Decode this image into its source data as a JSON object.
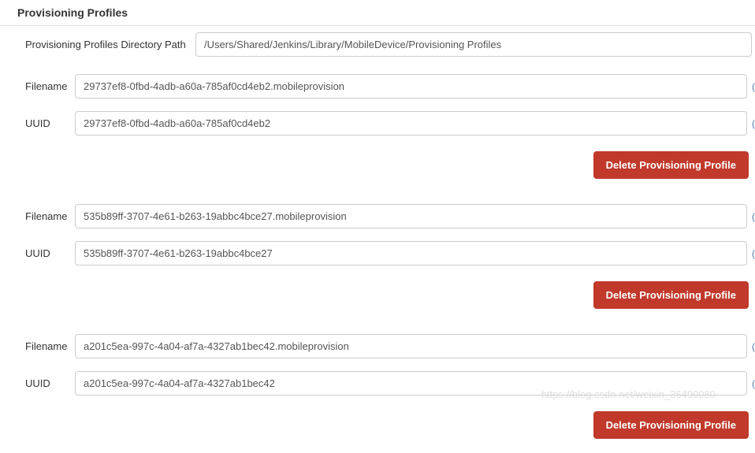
{
  "section_title": "Provisioning Profiles",
  "directory_path": {
    "label": "Provisioning Profiles Directory Path",
    "value": "/Users/Shared/Jenkins/Library/MobileDevice/Provisioning Profiles"
  },
  "filename_label": "Filename",
  "uuid_label": "UUID",
  "delete_button_label": "Delete Provisioning Profile",
  "profiles": [
    {
      "filename": "29737ef8-0fbd-4adb-a60a-785af0cd4eb2.mobileprovision",
      "uuid": "29737ef8-0fbd-4adb-a60a-785af0cd4eb2"
    },
    {
      "filename": "535b89ff-3707-4e61-b263-19abbc4bce27.mobileprovision",
      "uuid": "535b89ff-3707-4e61-b263-19abbc4bce27"
    },
    {
      "filename": "a201c5ea-997c-4a04-af7a-4327ab1bec42.mobileprovision",
      "uuid": "a201c5ea-997c-4a04-af7a-4327ab1bec42"
    }
  ],
  "watermark": "https://blog.csdn.net/weixin_36490080"
}
